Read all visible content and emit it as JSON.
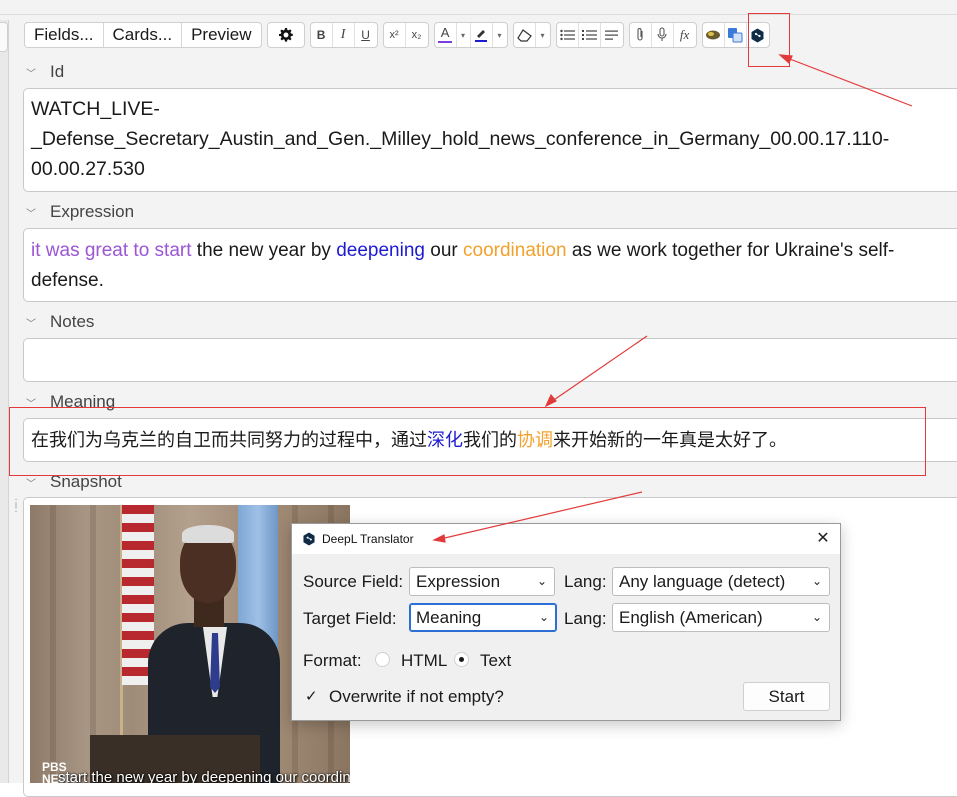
{
  "toolbar": {
    "fields_label": "Fields...",
    "cards_label": "Cards...",
    "preview_label": "Preview",
    "settings_icon": "gear-icon",
    "format_icons": [
      "bold-icon",
      "italic-icon",
      "underline-icon",
      "superscript-icon",
      "subscript-icon",
      "text-color-icon",
      "highlight-icon",
      "eraser-icon",
      "bullet-list-icon",
      "numbered-list-icon",
      "align-icon",
      "attach-icon",
      "record-icon",
      "formula-icon",
      "addon-icon",
      "translate-icon",
      "deepl-icon"
    ],
    "bold": "B",
    "italic": "I",
    "underline": "U",
    "superscript": "x²",
    "subscript": "x₂",
    "text_color": "A",
    "formula": "fx",
    "text_color_bar": "#7b3ce0",
    "highlight_bar": "#1d1bd0"
  },
  "fields": {
    "id": {
      "label": "Id",
      "value_line1": "WATCH_LIVE-",
      "value_line2": "_Defense_Secretary_Austin_and_Gen._Milley_hold_news_conference_in_Germany_00.00.17.110-",
      "value_line3": "00.00.27.530"
    },
    "expression": {
      "label": "Expression",
      "seg_purple": "it was great to start",
      "seg_plain1": " the new year by ",
      "seg_blue": "deepening",
      "seg_plain2": " our ",
      "seg_orange": "coordination",
      "seg_plain3": " as we work together for Ukraine's self-",
      "seg_plain4": "defense."
    },
    "notes": {
      "label": "Notes",
      "value": ""
    },
    "meaning": {
      "label": "Meaning",
      "seg1": "在我们为乌克兰的自卫而共同努力的过程中，通过",
      "seg_blue": "深化",
      "seg2": "我们的",
      "seg_orange": "协调",
      "seg3": "来开始新的一年真是太好了。"
    },
    "snapshot": {
      "label": "Snapshot",
      "logo": "PBS NEWS",
      "caption": "start the new year by deepening our coordination"
    }
  },
  "dialog": {
    "title": "DeepL Translator",
    "source_field_label": "Source Field:",
    "source_field_value": "Expression",
    "source_lang_label": "Lang:",
    "source_lang_value": "Any language (detect)",
    "target_field_label": "Target Field:",
    "target_field_value": "Meaning",
    "target_lang_label": "Lang:",
    "target_lang_value": "English (American)",
    "format_label": "Format:",
    "format_html": "HTML",
    "format_text": "Text",
    "format_selected": "Text",
    "overwrite_label": "Overwrite if not empty?",
    "overwrite_checked": true,
    "start_label": "Start"
  },
  "colors": {
    "purple": "#9b55d6",
    "blue": "#1d1bd0",
    "orange": "#f3a12c",
    "annotation_red": "#e23a3a",
    "deepl_navy": "#0f2b46"
  }
}
